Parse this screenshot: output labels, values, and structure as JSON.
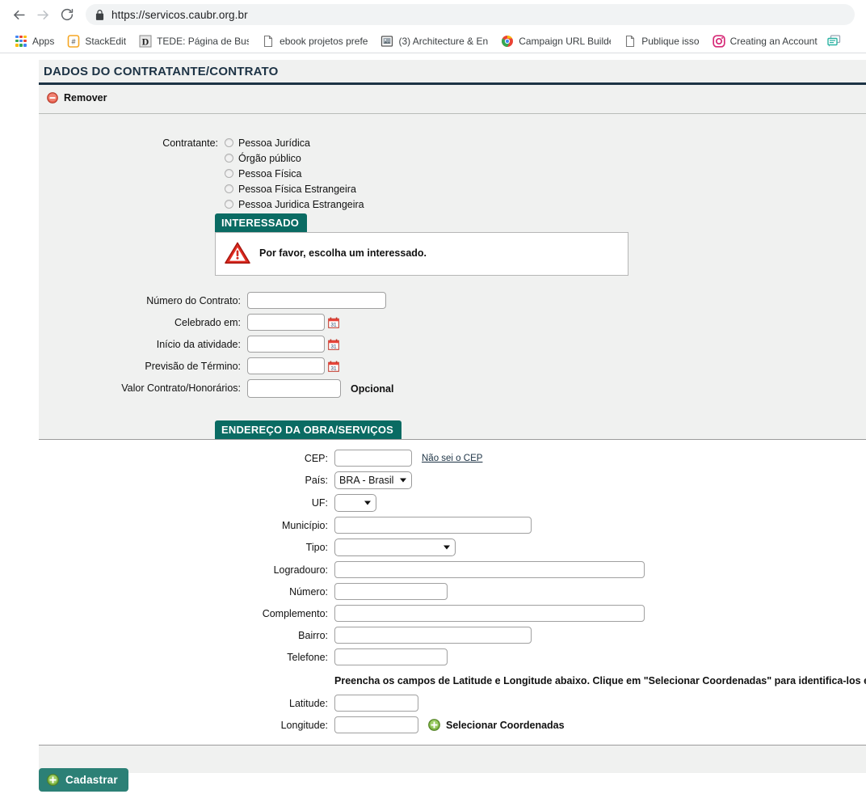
{
  "browser": {
    "url": "https://servicos.caubr.org.br",
    "nav": {
      "back": "back-arrow",
      "forward": "forward-arrow",
      "reload": "reload",
      "lock": "lock-icon"
    },
    "bookmarks": [
      {
        "label": "Apps",
        "icon": "apps-grid-icon"
      },
      {
        "label": "StackEdit",
        "icon": "stackedit-icon"
      },
      {
        "label": "TEDE: Página de Busc",
        "icon": "tede-icon"
      },
      {
        "label": "ebook projetos prefe",
        "icon": "document-icon"
      },
      {
        "label": "(3) Architecture & En",
        "icon": "image-icon"
      },
      {
        "label": "Campaign URL Builde",
        "icon": "chrome-icon"
      },
      {
        "label": "Publique isso",
        "icon": "document-icon"
      },
      {
        "label": "Creating an Account",
        "icon": "instagram-icon"
      },
      {
        "label": "",
        "icon": "chat-bubble-icon"
      }
    ]
  },
  "panel": {
    "title": "DADOS DO CONTRATANTE/CONTRATO",
    "remove_label": "Remover"
  },
  "contratante": {
    "label": "Contratante:",
    "options": [
      "Pessoa Jurídica",
      "Órgão público",
      "Pessoa Física",
      "Pessoa Física Estrangeira",
      "Pessoa Juridica Estrangeira"
    ]
  },
  "interessado": {
    "header": "INTERESSADO",
    "message": "Por favor, escolha um interessado."
  },
  "contrato": {
    "numero_label": "Número do Contrato:",
    "numero_value": "",
    "celebrado_label": "Celebrado em:",
    "celebrado_value": "",
    "inicio_label": "Início da atividade:",
    "inicio_value": "",
    "previsao_label": "Previsão de Término:",
    "previsao_value": "",
    "valor_label": "Valor Contrato/Honorários:",
    "valor_value": "",
    "valor_hint": "Opcional"
  },
  "endereco": {
    "header": "ENDEREÇO DA OBRA/SERVIÇOS",
    "cep_label": "CEP:",
    "cep_value": "",
    "cep_link": "Não sei o CEP",
    "pais_label": "País:",
    "pais_value": "BRA - Brasil",
    "uf_label": "UF:",
    "uf_value": "",
    "municipio_label": "Município:",
    "municipio_value": "",
    "tipo_label": "Tipo:",
    "tipo_value": "",
    "logradouro_label": "Logradouro:",
    "logradouro_value": "",
    "numero_label": "Número:",
    "numero_value": "",
    "complemento_label": "Complemento:",
    "complemento_value": "",
    "bairro_label": "Bairro:",
    "bairro_value": "",
    "telefone_label": "Telefone:",
    "telefone_value": "",
    "coord_note": "Preencha os campos de Latitude e Longitude abaixo. Clique em \"Selecionar Coordenadas\" para identifica-los em mapa",
    "latitude_label": "Latitude:",
    "latitude_value": "",
    "longitude_label": "Longitude:",
    "longitude_value": "",
    "select_coord_label": "Selecionar Coordenadas"
  },
  "footer": {
    "submit_label": "Cadastrar"
  },
  "colors": {
    "teal_header": "#0a6b63",
    "teal_button": "#2c8076",
    "navy_title": "#1d3345",
    "panel_bg": "#f0f1f0",
    "green_plus": "#6aa84f",
    "red_minus": "#e06666"
  }
}
